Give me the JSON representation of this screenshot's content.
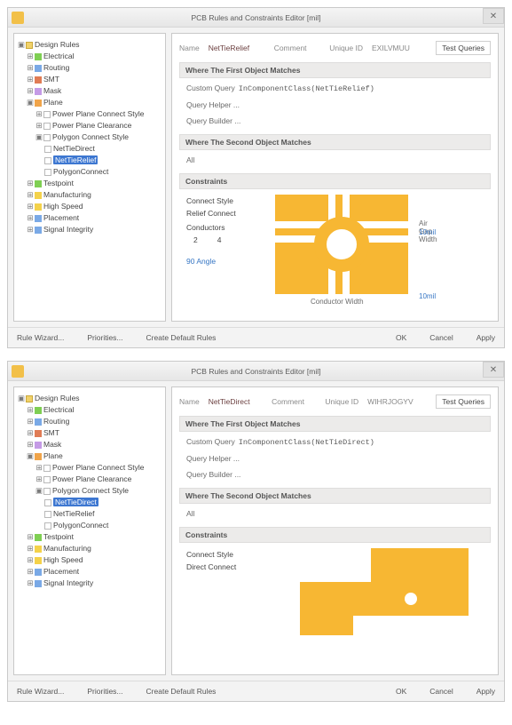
{
  "window_title": "PCB Rules and Constraints Editor [mil]",
  "footer": {
    "rule_wizard": "Rule Wizard...",
    "priorities": "Priorities...",
    "create_default": "Create Default Rules",
    "ok": "OK",
    "cancel": "Cancel",
    "apply": "Apply"
  },
  "tree": {
    "root": "Design Rules",
    "electrical": "Electrical",
    "routing": "Routing",
    "smt": "SMT",
    "mask": "Mask",
    "plane": "Plane",
    "ppcs": "Power Plane Connect Style",
    "ppcl": "Power Plane Clearance",
    "pcs": "Polygon Connect Style",
    "ntd": "NetTieDirect",
    "ntr": "NetTieRelief",
    "pc": "PolygonConnect",
    "testpoint": "Testpoint",
    "manufacturing": "Manufacturing",
    "highspeed": "High Speed",
    "placement": "Placement",
    "signal": "Signal Integrity"
  },
  "labels": {
    "name": "Name",
    "comment": "Comment",
    "uniqueid": "Unique ID",
    "test_queries": "Test Queries",
    "where1": "Where The First Object Matches",
    "where2": "Where The Second Object Matches",
    "custom_query": "Custom Query",
    "query_helper": "Query Helper ...",
    "query_builder": "Query Builder ...",
    "all": "All",
    "constraints": "Constraints",
    "connect_style": "Connect Style",
    "conductors": "Conductors",
    "airgap": "Air Gap Width",
    "condwidth": "Conductor Width"
  },
  "top": {
    "name": "NetTieRelief",
    "uid": "EXILVMUU",
    "query": "InComponentClass(NetTieRelief)",
    "style": "Relief Connect",
    "cond2": "2",
    "cond4": "4",
    "angle": "90 Angle",
    "airgap_val": "10mil",
    "condwidth_val": "10mil"
  },
  "bottom": {
    "name": "NetTieDirect",
    "uid": "WIHRJOGYV",
    "query": "InComponentClass(NetTieDirect)",
    "style": "Direct Connect"
  }
}
